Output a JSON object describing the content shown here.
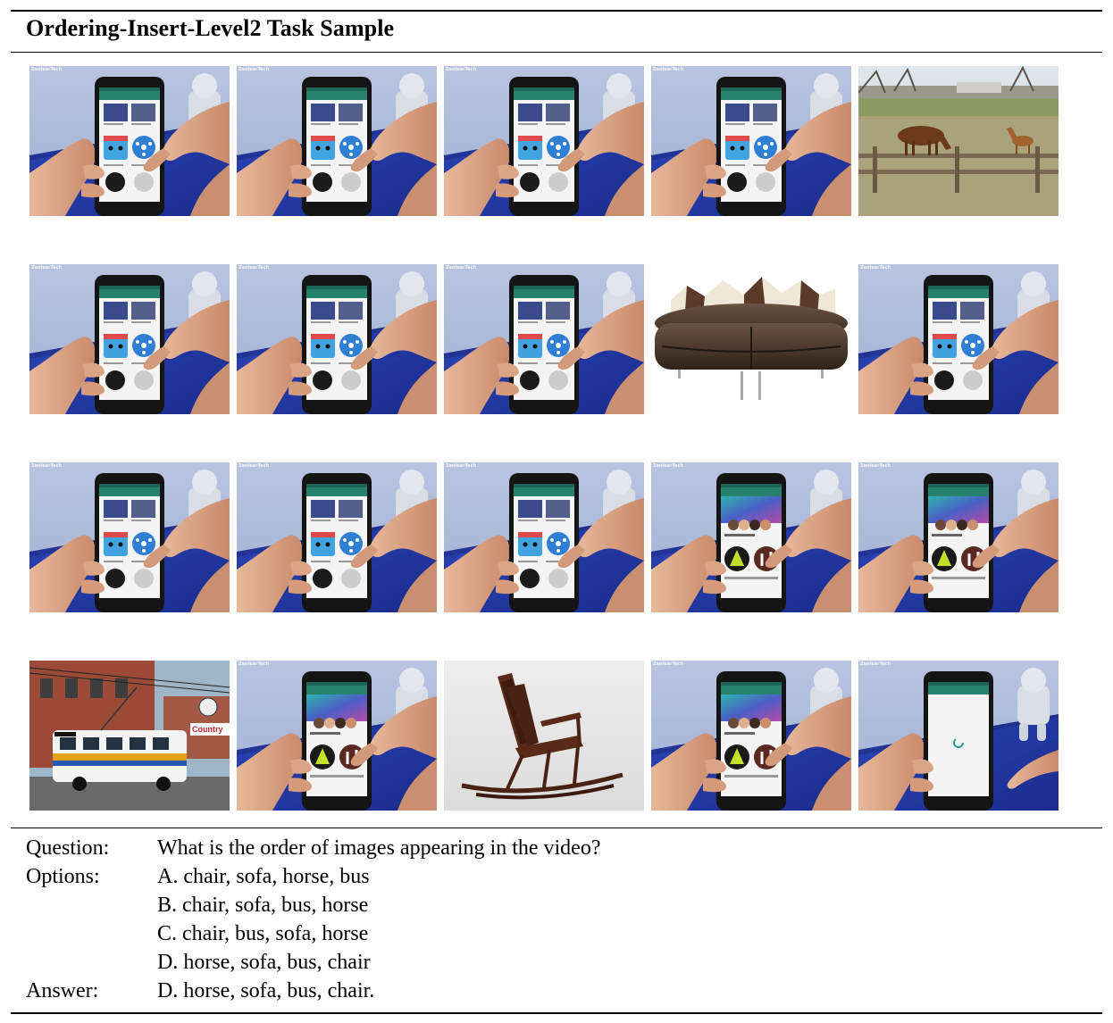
{
  "title": "Ordering-Insert-Level2 Task Sample",
  "watermark": "ZanlearTech",
  "frames": [
    [
      "phone-tap",
      "phone-tap",
      "phone-tap",
      "phone-tap",
      "horse"
    ],
    [
      "phone-tap",
      "phone-tap",
      "phone-tap",
      "sofa",
      "phone-tap"
    ],
    [
      "phone-tap",
      "phone-tap",
      "phone-tap",
      "phone-playstore",
      "phone-playstore"
    ],
    [
      "bus",
      "phone-playstore",
      "rocking-chair",
      "phone-playstore",
      "phone-loading"
    ]
  ],
  "question_label": "Question:",
  "question": "What is the order of images appearing in the video?",
  "options_label": "Options:",
  "options": [
    "A. chair, sofa, horse, bus",
    "B. chair, sofa, bus, horse",
    "C. chair, bus, sofa, horse",
    "D. horse, sofa, bus, chair"
  ],
  "answer_label": "Answer:",
  "answer": "D. horse, sofa, bus, chair.",
  "bus_sign": "Country"
}
